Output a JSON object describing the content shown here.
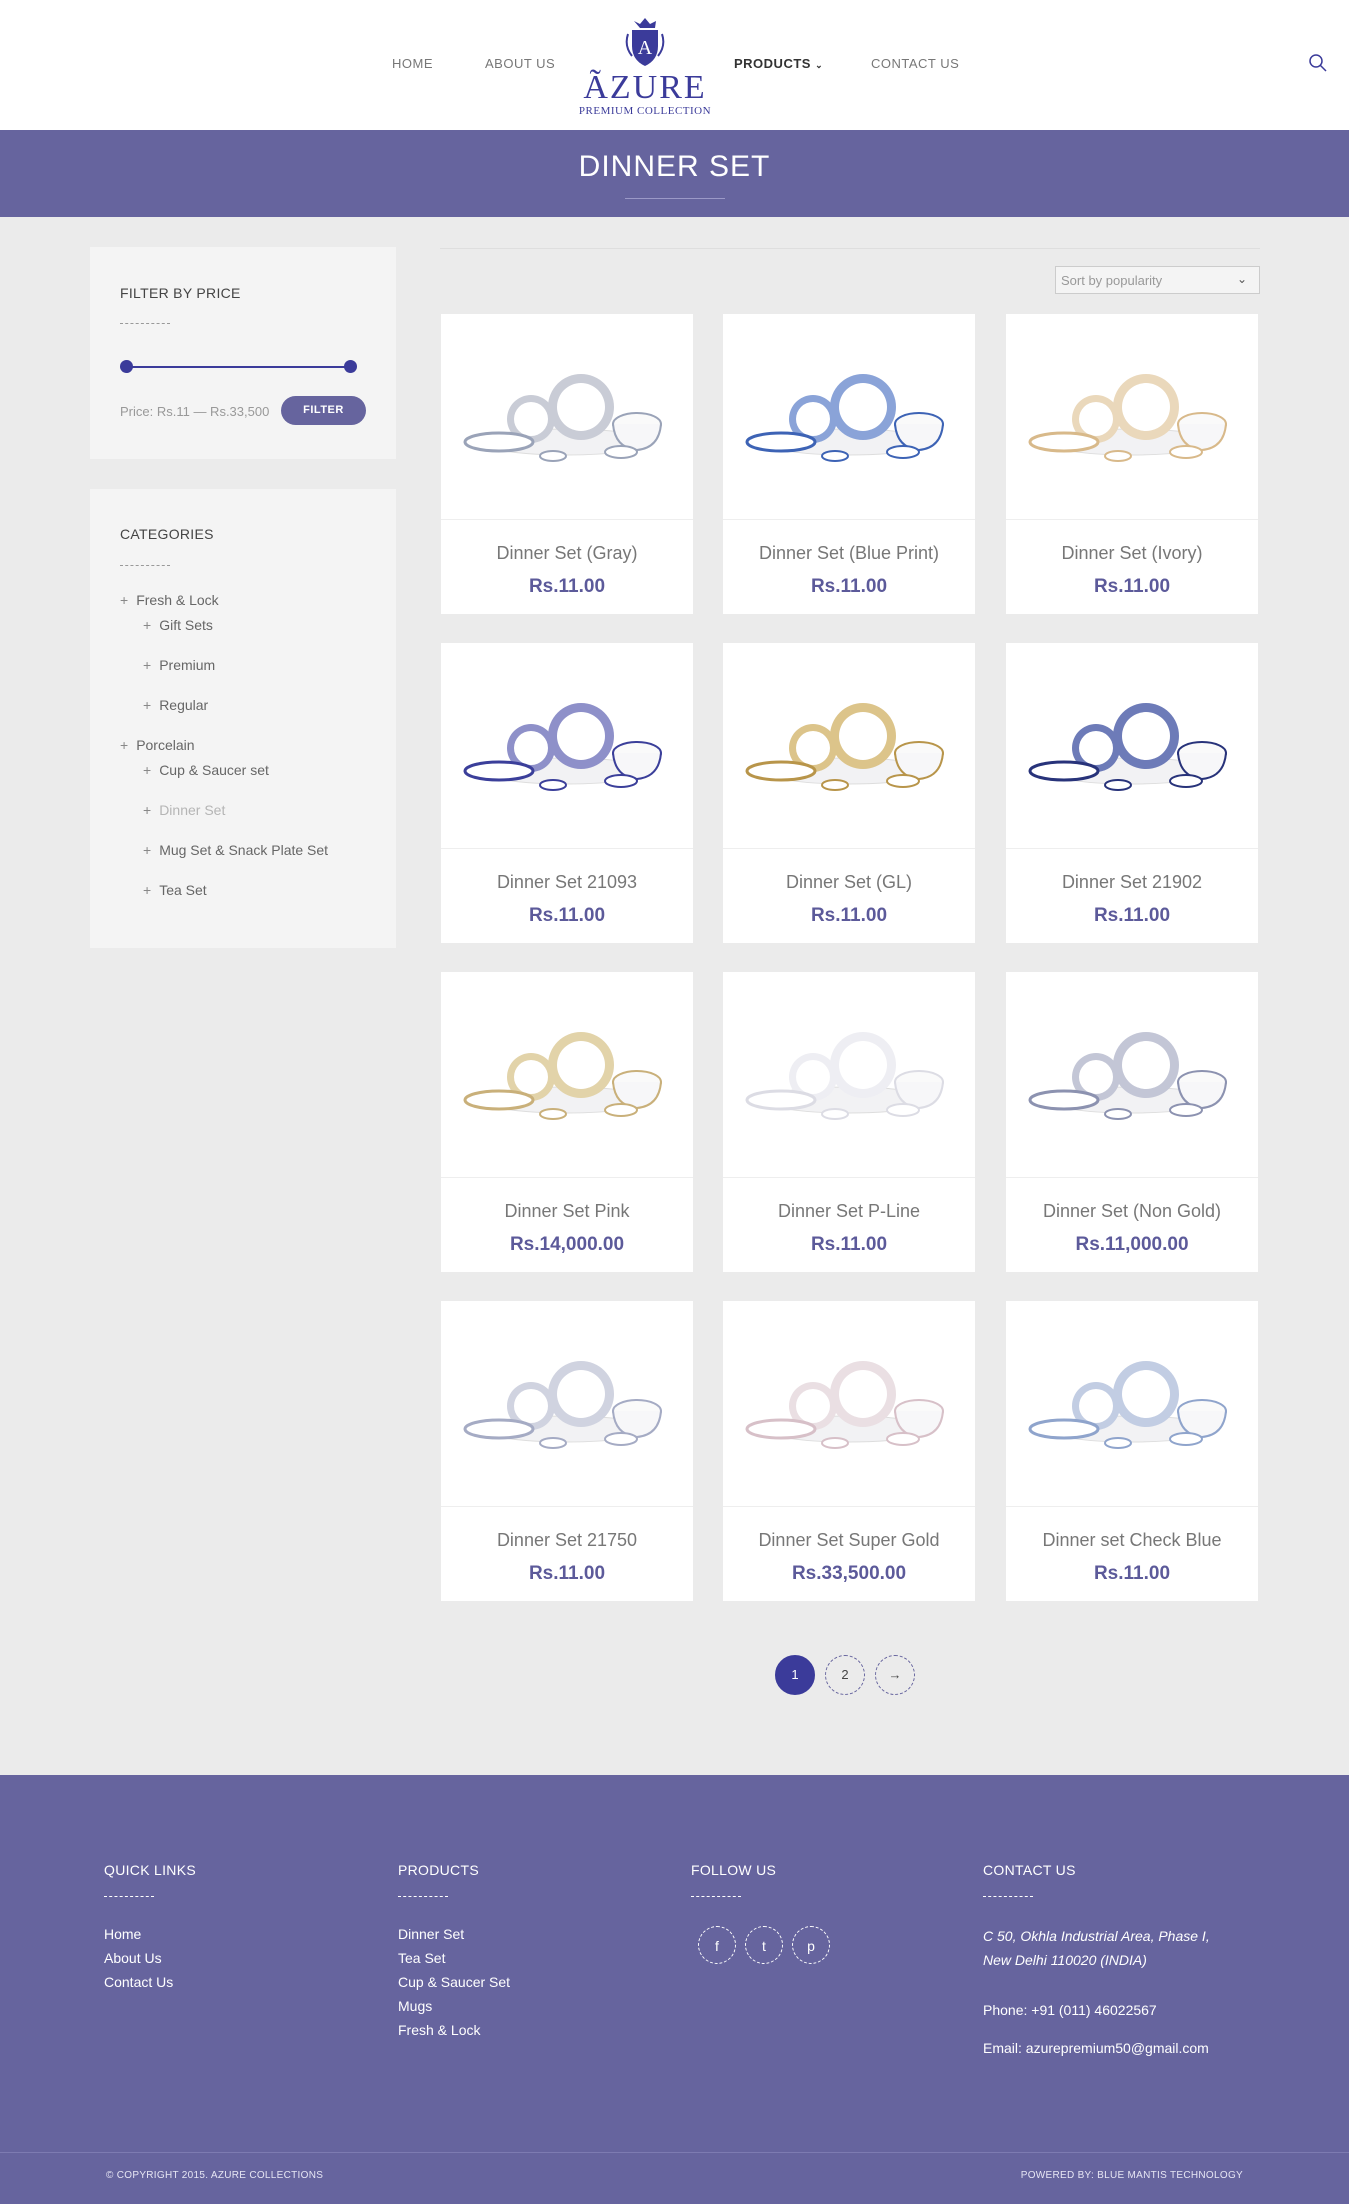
{
  "header": {
    "nav": [
      "HOME",
      "ABOUT US",
      "PRODUCTS",
      "CONTACT US"
    ],
    "logo": {
      "letter": "A",
      "brand": "ÃZURE",
      "tagline": "PREMIUM COLLECTION"
    },
    "search_icon": "search-icon"
  },
  "banner": {
    "title": "DINNER SET"
  },
  "sidebar": {
    "price_filter": {
      "title": "FILTER BY PRICE",
      "range_text": "Price: Rs.11 — Rs.33,500",
      "min": 11,
      "max": 33500,
      "button": "FILTER"
    },
    "categories": {
      "title": "CATEGORIES",
      "items": [
        "Fresh & Lock",
        "Gift Sets",
        "Premium",
        "Regular",
        "Porcelain",
        "Cup & Saucer set",
        "Dinner Set",
        "Mug Set & Snack Plate Set",
        "Tea Set"
      ],
      "current": "Dinner Set"
    }
  },
  "sort": {
    "selected": "Sort by popularity"
  },
  "products": [
    {
      "name": "Dinner Set (Gray)",
      "price": "Rs.11.00"
    },
    {
      "name": "Dinner Set (Blue Print)",
      "price": "Rs.11.00"
    },
    {
      "name": "Dinner Set (Ivory)",
      "price": "Rs.11.00"
    },
    {
      "name": "Dinner Set 21093",
      "price": "Rs.11.00"
    },
    {
      "name": "Dinner Set (GL)",
      "price": "Rs.11.00"
    },
    {
      "name": "Dinner Set 21902",
      "price": "Rs.11.00"
    },
    {
      "name": "Dinner Set Pink",
      "price": "Rs.14,000.00"
    },
    {
      "name": "Dinner Set P-Line",
      "price": "Rs.11.00"
    },
    {
      "name": "Dinner Set (Non Gold)",
      "price": "Rs.11,000.00"
    },
    {
      "name": "Dinner Set 21750",
      "price": "Rs.11.00"
    },
    {
      "name": "Dinner Set Super Gold",
      "price": "Rs.33,500.00"
    },
    {
      "name": "Dinner set Check Blue",
      "price": "Rs.11.00"
    }
  ],
  "pagination": {
    "pages": [
      "1",
      "2"
    ],
    "current": "1",
    "next": "→"
  },
  "footer": {
    "quick_links": {
      "title": "QUICK LINKS",
      "links": [
        "Home",
        "About Us",
        "Contact Us"
      ]
    },
    "products": {
      "title": "PRODUCTS",
      "links": [
        "Dinner Set",
        "Tea Set",
        "Cup & Saucer Set",
        "Mugs",
        "Fresh & Lock"
      ]
    },
    "follow": {
      "title": "FOLLOW US",
      "icons": [
        "facebook-icon",
        "twitter-icon",
        "pinterest-icon"
      ],
      "glyphs": [
        "f",
        "t",
        "p"
      ]
    },
    "contact": {
      "title": "CONTACT US",
      "address_line1": "C 50, Okhla Industrial Area, Phase I,",
      "address_line2": "New Delhi 110020 (INDIA)",
      "phone": "Phone: +91 (011) 46022567",
      "email": "Email: azurepremium50@gmail.com"
    },
    "copyright": "© COPYRIGHT 2015. AZURE COLLECTIONS",
    "powered_by": "POWERED BY: BLUE MANTIS TECHNOLOGY"
  },
  "colors": {
    "brand": "#66649e",
    "accent": "#3b3b9a",
    "price": "#5c5a9a"
  }
}
